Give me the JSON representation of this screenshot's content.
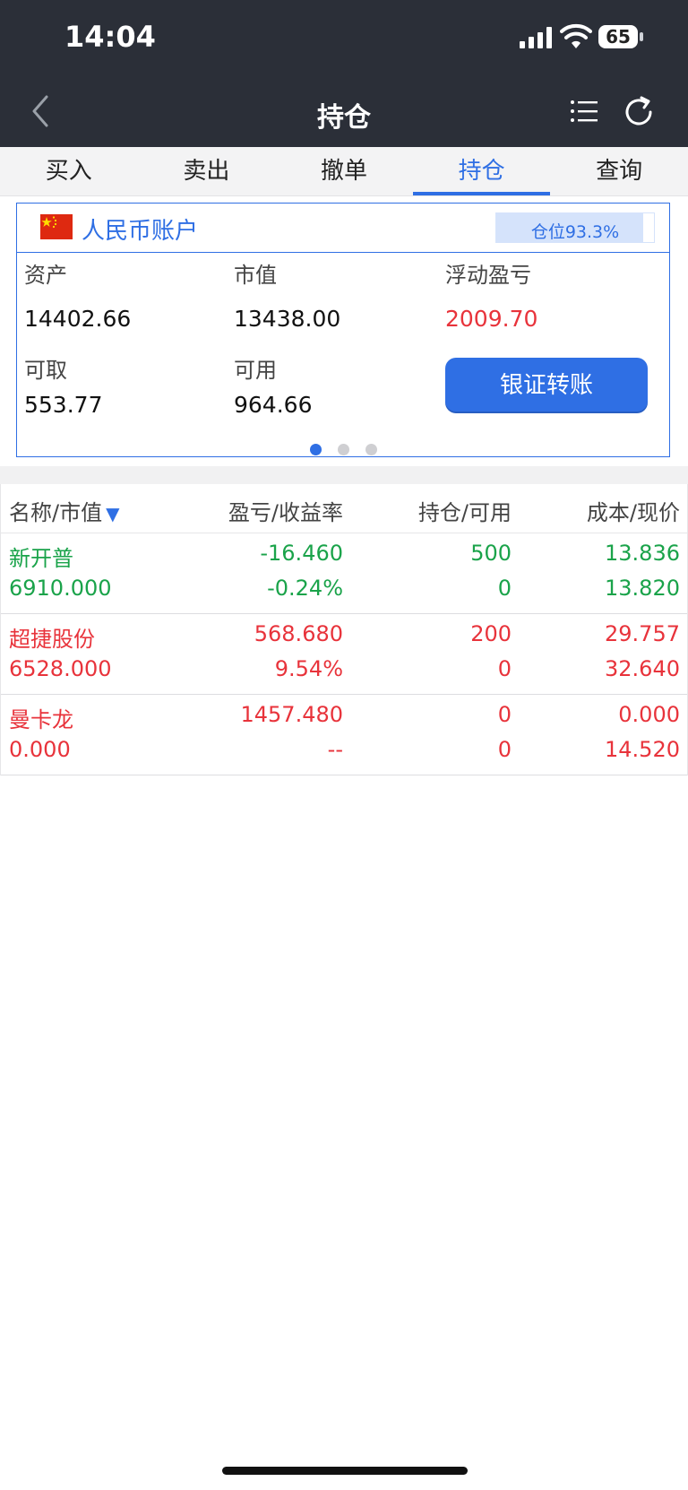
{
  "status_bar": {
    "time": "14:04",
    "battery": "65"
  },
  "nav": {
    "title": "持仓"
  },
  "tabs": [
    {
      "label": "买入",
      "active": false
    },
    {
      "label": "卖出",
      "active": false
    },
    {
      "label": "撤单",
      "active": false
    },
    {
      "label": "持仓",
      "active": true
    },
    {
      "label": "查询",
      "active": false
    }
  ],
  "account": {
    "title": "人民币账户",
    "position_label": "仓位93.3%",
    "position_percent": 93.3,
    "labels": {
      "assets": "资产",
      "market_value": "市值",
      "floating_pl": "浮动盈亏",
      "withdrawable": "可取",
      "available": "可用"
    },
    "values": {
      "assets": "14402.66",
      "market_value": "13438.00",
      "floating_pl": "2009.70",
      "withdrawable": "553.77",
      "available": "964.66"
    },
    "transfer_button": "银证转账",
    "page_dots": 3,
    "active_dot": 0
  },
  "holdings": {
    "headers": {
      "name": "名称/市值",
      "sort_icon": "▼",
      "pl": "盈亏/收益率",
      "position": "持仓/可用",
      "cost": "成本/现价"
    },
    "rows": [
      {
        "name": "新开普",
        "value": "6910.000",
        "pl": "-16.460",
        "rate": "-0.24%",
        "hold": "500",
        "avail": "0",
        "cost": "13.836",
        "price": "13.820",
        "color": "green"
      },
      {
        "name": "超捷股份",
        "value": "6528.000",
        "pl": "568.680",
        "rate": "9.54%",
        "hold": "200",
        "avail": "0",
        "cost": "29.757",
        "price": "32.640",
        "color": "red"
      },
      {
        "name": "曼卡龙",
        "value": "0.000",
        "pl": "1457.480",
        "rate": "--",
        "hold": "0",
        "avail": "0",
        "cost": "0.000",
        "price": "14.520",
        "color": "red"
      }
    ]
  },
  "colors": {
    "accent": "#2f6fe4",
    "up": "#e8333b",
    "down": "#1aa34a",
    "header_bg": "#2b2f38"
  }
}
